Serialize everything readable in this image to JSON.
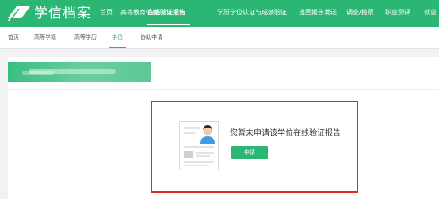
{
  "app": {
    "logo_text": "学信档案"
  },
  "nav": {
    "items": [
      {
        "label": "首页"
      },
      {
        "label": "高等教育信息"
      },
      {
        "label": "在线验证报告"
      },
      {
        "label": "学历学位认证与成绩验证"
      },
      {
        "label": "出国报告发送"
      },
      {
        "label": "调查/投票"
      },
      {
        "label": "职业测评"
      },
      {
        "label": "就业"
      }
    ],
    "active_index": 2
  },
  "subnav": {
    "items": [
      {
        "label": "首页"
      },
      {
        "label": "高等学籍"
      },
      {
        "label": "高等学历"
      },
      {
        "label": "学位"
      },
      {
        "label": "协助申请"
      }
    ],
    "active_index": 3
  },
  "empty_state": {
    "message": "您暂未申请该学位在线验证报告",
    "button_label": "申请"
  },
  "colors": {
    "brand_green": "#2bb674",
    "highlight_red": "#e2262a",
    "page_bg": "#f2f2f2"
  }
}
